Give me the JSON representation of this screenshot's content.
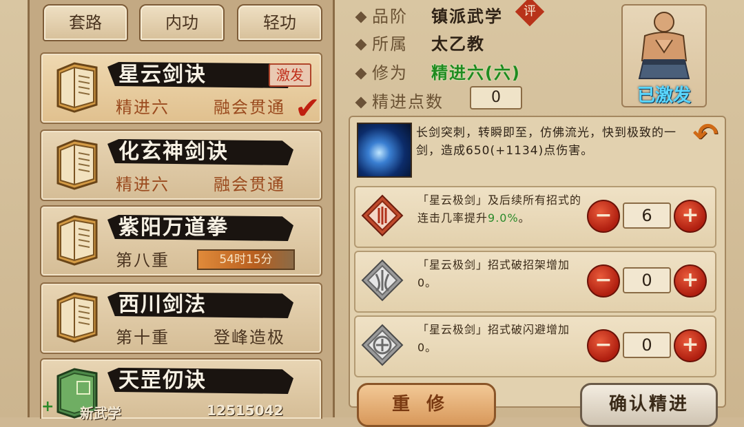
{
  "tabs": [
    {
      "label": "套路"
    },
    {
      "label": "内功"
    },
    {
      "label": "轻功"
    }
  ],
  "skills": [
    {
      "name": "星云剑诀",
      "level": "精进六",
      "status": "融会贯通",
      "badge": "激发",
      "selected": true
    },
    {
      "name": "化玄神剑诀",
      "level": "精进六",
      "status": "融会贯通"
    },
    {
      "name": "紫阳万道拳",
      "level": "第八重",
      "timer": "54时15分"
    },
    {
      "name": "西川剑法",
      "level": "第十重",
      "status": "登峰造极"
    },
    {
      "name": "天罡仞诀"
    }
  ],
  "bottom": {
    "label": "新武学",
    "value": "12515042"
  },
  "attributes": {
    "grade_label": "品阶",
    "grade_value": "镇派武学",
    "review_badge": "评",
    "sect_label": "所属",
    "sect_value": "太乙教",
    "cultivation_label": "修为",
    "cultivation_value": "精进六(六)",
    "points_label": "精进点数",
    "points_value": "0"
  },
  "portrait": {
    "status": "已激发"
  },
  "skill_description": "长剑突刺，转瞬即至，仿佛流光，快到极致的一剑，造成650(+1134)点伤害。",
  "effects": [
    {
      "text": "「星云极剑」及后续所有招式的连击几率提升",
      "highlight": "9.0%",
      "suffix": "。",
      "value": "6"
    },
    {
      "text": "「星云极剑」招式破招架增加0。",
      "highlight": "",
      "suffix": "",
      "value": "0"
    },
    {
      "text": "「星云极剑」招式破闪避增加0。",
      "highlight": "",
      "suffix": "",
      "value": "0"
    }
  ],
  "buttons": {
    "reset": "重修",
    "confirm": "确认精进"
  },
  "colors": {
    "accent_red": "#b8331a",
    "green_text": "#1f8a1f",
    "cyan_status": "#5ad7ff"
  }
}
